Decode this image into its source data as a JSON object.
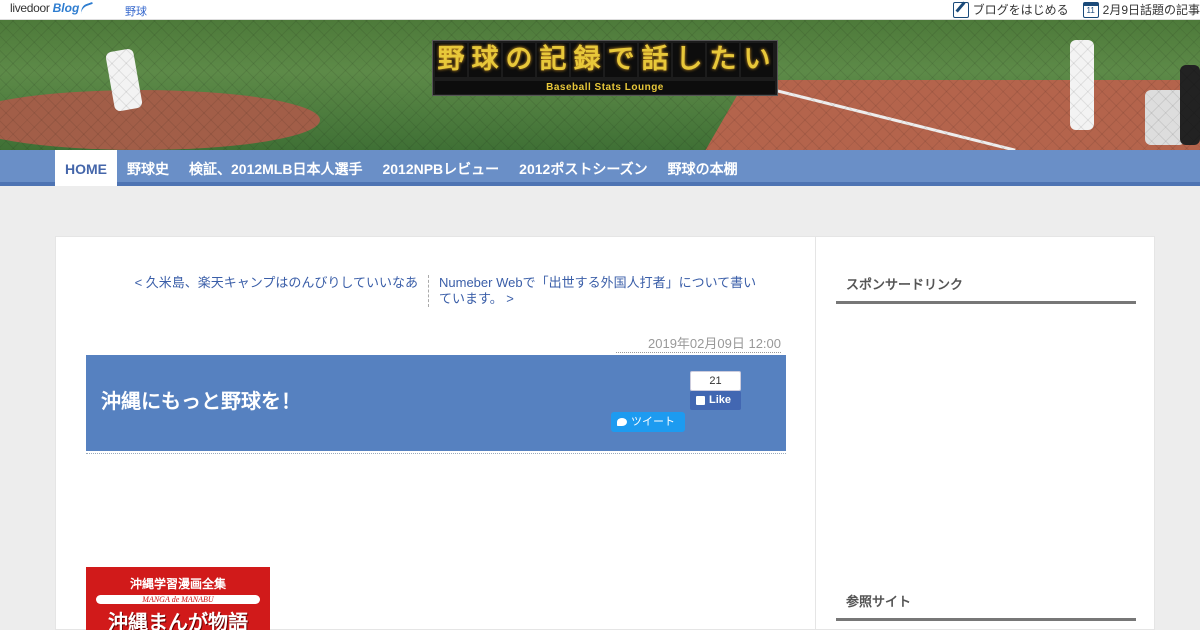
{
  "topbar": {
    "brand": "livedoor",
    "brand_blog": "Blog",
    "category": "野球",
    "start_blog": "ブログをはじめる",
    "topics_day": "11",
    "topics": "2月9日話題の記事"
  },
  "header": {
    "title_chars": [
      "野",
      "球",
      "の",
      "記",
      "録",
      "で",
      "話",
      "し",
      "た",
      "い"
    ],
    "subtitle": "Baseball Stats Lounge"
  },
  "nav": {
    "items": [
      "HOME",
      "野球史",
      "検証、2012MLB日本人選手",
      "2012NPBレビュー",
      "2012ポストシーズン",
      "野球の本棚"
    ]
  },
  "article": {
    "prev_link": "< 久米島、楽天キャンプはのんびりしていいなあ",
    "next_link": "Numeber Webで「出世する外国人打者」について書いています。 >",
    "date": "2019年02月09日 12:00",
    "title": "沖縄にもっと野球を！",
    "fb_count": "21",
    "fb_like": "Like",
    "tweet": "ツイート",
    "book_title": "沖縄学習漫画全集",
    "book_sub": "MANGA de MANABU",
    "book_main": "沖縄まんが物語"
  },
  "sidebar": {
    "sponsor": "スポンサードリンク",
    "reference": "参照サイト"
  },
  "colors": {
    "nav": "#6a8fc7",
    "title_box": "#5681c0",
    "link": "#3a5ea8"
  }
}
